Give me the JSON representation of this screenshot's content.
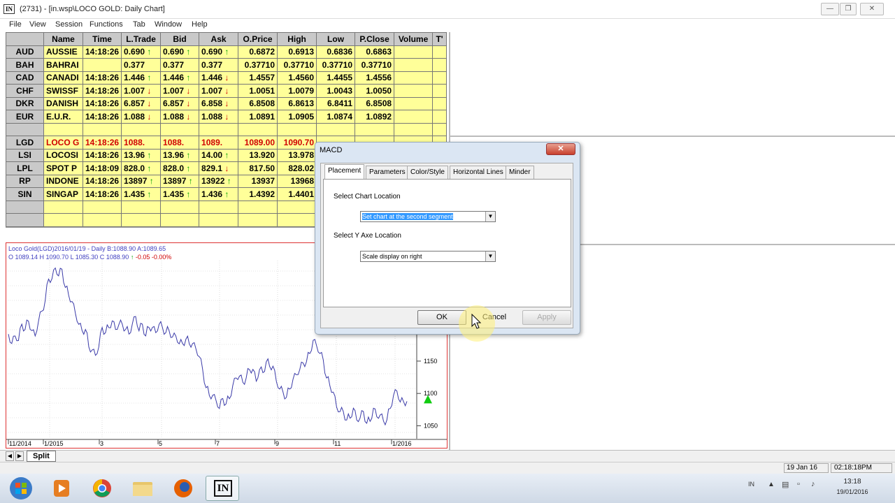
{
  "window": {
    "icon_text": "IN",
    "title": "(2731) - [in.wsp\\LOCO GOLD: Daily Chart]"
  },
  "menu": [
    "File",
    "View",
    "Session",
    "Functions",
    "Tab",
    "Window",
    "Help"
  ],
  "quotes": {
    "columns": [
      "",
      "Name",
      "Time",
      "L.Trade",
      "Bid",
      "Ask",
      "O.Price",
      "High",
      "Low",
      "P.Close",
      "Volume",
      "T'"
    ],
    "rows": [
      {
        "code": "AUD",
        "name": "AUSSIE",
        "time": "14:18:26",
        "ltrade": "0.690",
        "lt_dir": "up",
        "bid": "0.690",
        "bid_dir": "up",
        "ask": "0.690",
        "ask_dir": "up",
        "open": "0.6872",
        "high": "0.6913",
        "low": "0.6836",
        "pclose": "0.6863",
        "red": false
      },
      {
        "code": "BAH",
        "name": "BAHRAI",
        "time": "",
        "ltrade": "0.377",
        "lt_dir": "",
        "bid": "0.377",
        "bid_dir": "",
        "ask": "0.377",
        "ask_dir": "",
        "open": "0.37710",
        "high": "0.37710",
        "low": "0.37710",
        "pclose": "0.37710",
        "red": false
      },
      {
        "code": "CAD",
        "name": "CANADI",
        "time": "14:18:26",
        "ltrade": "1.446",
        "lt_dir": "up",
        "bid": "1.446",
        "bid_dir": "up",
        "ask": "1.446",
        "ask_dir": "down",
        "open": "1.4557",
        "high": "1.4560",
        "low": "1.4455",
        "pclose": "1.4556",
        "red": false
      },
      {
        "code": "CHF",
        "name": "SWISSF",
        "time": "14:18:26",
        "ltrade": "1.007",
        "lt_dir": "down",
        "bid": "1.007",
        "bid_dir": "down",
        "ask": "1.007",
        "ask_dir": "down",
        "open": "1.0051",
        "high": "1.0079",
        "low": "1.0043",
        "pclose": "1.0050",
        "red": false
      },
      {
        "code": "DKR",
        "name": "DANISH",
        "time": "14:18:26",
        "ltrade": "6.857",
        "lt_dir": "down",
        "bid": "6.857",
        "bid_dir": "down",
        "ask": "6.858",
        "ask_dir": "down",
        "open": "6.8508",
        "high": "6.8613",
        "low": "6.8411",
        "pclose": "6.8508",
        "red": false
      },
      {
        "code": "EUR",
        "name": "E.U.R.",
        "time": "14:18:26",
        "ltrade": "1.088",
        "lt_dir": "down",
        "bid": "1.088",
        "bid_dir": "down",
        "ask": "1.088",
        "ask_dir": "down",
        "open": "1.0891",
        "high": "1.0905",
        "low": "1.0874",
        "pclose": "1.0892",
        "red": false
      },
      {
        "code": "",
        "name": "",
        "time": "",
        "ltrade": "",
        "lt_dir": "",
        "bid": "",
        "bid_dir": "",
        "ask": "",
        "ask_dir": "",
        "open": "",
        "high": "",
        "low": "",
        "pclose": "",
        "red": false
      },
      {
        "code": "LGD",
        "name": "LOCO G",
        "time": "14:18:26",
        "ltrade": "1088.",
        "lt_dir": "",
        "bid": "1088.",
        "bid_dir": "",
        "ask": "1089.",
        "ask_dir": "",
        "open": "1089.00",
        "high": "1090.70",
        "low": "",
        "pclose": "",
        "red": true
      },
      {
        "code": "LSI",
        "name": "LOCOSI",
        "time": "14:18:26",
        "ltrade": "13.96",
        "lt_dir": "up",
        "bid": "13.96",
        "bid_dir": "up",
        "ask": "14.00",
        "ask_dir": "up",
        "open": "13.920",
        "high": "13.978",
        "low": "",
        "pclose": "",
        "red": false
      },
      {
        "code": "LPL",
        "name": "SPOT P",
        "time": "14:18:09",
        "ltrade": "828.0",
        "lt_dir": "up",
        "bid": "828.0",
        "bid_dir": "up",
        "ask": "829.1",
        "ask_dir": "down",
        "open": "817.50",
        "high": "828.02",
        "low": "",
        "pclose": "",
        "red": false
      },
      {
        "code": "RP",
        "name": "INDONE",
        "time": "14:18:26",
        "ltrade": "13897",
        "lt_dir": "up",
        "bid": "13897",
        "bid_dir": "up",
        "ask": "13922",
        "ask_dir": "up",
        "open": "13937",
        "high": "13968",
        "low": "",
        "pclose": "",
        "red": false
      },
      {
        "code": "SIN",
        "name": "SINGAP",
        "time": "14:18:26",
        "ltrade": "1.435",
        "lt_dir": "up",
        "bid": "1.435",
        "bid_dir": "up",
        "ask": "1.436",
        "ask_dir": "up",
        "open": "1.4392",
        "high": "1.4401",
        "low": "",
        "pclose": "",
        "red": false
      },
      {
        "code": "",
        "name": "",
        "time": "",
        "ltrade": "",
        "lt_dir": "",
        "bid": "",
        "bid_dir": "",
        "ask": "",
        "ask_dir": "",
        "open": "",
        "high": "",
        "low": "",
        "pclose": "",
        "red": false
      },
      {
        "code": "",
        "name": "",
        "time": "",
        "ltrade": "",
        "lt_dir": "",
        "bid": "",
        "bid_dir": "",
        "ask": "",
        "ask_dir": "",
        "open": "",
        "high": "",
        "low": "",
        "pclose": "",
        "red": false
      }
    ]
  },
  "chart": {
    "header1": "Loco Gold(LGD)2016/01/19  - Daily B:1088.90 A:1089.65",
    "header2": "O 1089.14 H 1090.70 L 1085.30 C 1088.90",
    "change": "-0.05 -0.00%",
    "colors": {
      "line": "#3a3aa8",
      "border": "#dd3333",
      "marker": "#11cc11"
    }
  },
  "chart_data": {
    "type": "line",
    "title": "",
    "x_ticks": [
      "11/2014",
      "1/2015",
      "3",
      "5",
      "7",
      "9",
      "11",
      "1/2016"
    ],
    "y_ticks": [
      1150,
      1100,
      1050
    ],
    "ylim": [
      1030,
      1300
    ],
    "series": [
      {
        "values": [
          1195,
          1175,
          1190,
          1185,
          1205,
          1200,
          1215,
          1195,
          1190,
          1215,
          1225,
          1245,
          1280,
          1275,
          1295,
          1285,
          1290,
          1265,
          1255,
          1240,
          1225,
          1210,
          1195,
          1200,
          1175,
          1165,
          1160,
          1175,
          1200,
          1195,
          1205,
          1210,
          1200,
          1210,
          1205,
          1200,
          1195,
          1205,
          1220,
          1200,
          1205,
          1190,
          1205,
          1200,
          1195,
          1210,
          1200,
          1195,
          1200,
          1185,
          1190,
          1180,
          1175,
          1185,
          1180,
          1175,
          1170,
          1160,
          1135,
          1110,
          1100,
          1095,
          1090,
          1080,
          1090,
          1085,
          1095,
          1110,
          1125,
          1130,
          1115,
          1125,
          1140,
          1135,
          1120,
          1140,
          1130,
          1150,
          1145,
          1140,
          1120,
          1110,
          1100,
          1095,
          1110,
          1120,
          1130,
          1140,
          1145,
          1150,
          1165,
          1180,
          1175,
          1165,
          1150,
          1125,
          1115,
          1100,
          1080,
          1075,
          1070,
          1060,
          1065,
          1075,
          1060,
          1065,
          1070,
          1055,
          1060,
          1075,
          1065,
          1070,
          1055,
          1060,
          1080,
          1095,
          1105,
          1090,
          1085,
          1089
        ]
      }
    ]
  },
  "dialog": {
    "title": "MACD",
    "tabs": [
      "Placement",
      "Parameters",
      "Color/Style",
      "Horizontal Lines",
      "Minder"
    ],
    "active_tab": "Placement",
    "chart_location_label": "Select Chart Location",
    "chart_location_value": "Set chart at the second segment",
    "y_axis_label": "Select Y Axe Location",
    "y_axis_value": "Scale display on right",
    "ok": "OK",
    "cancel": "Cancel",
    "apply": "Apply"
  },
  "sheet_tab": "Split",
  "status": {
    "date": "19 Jan 16",
    "time": "02:18:18PM"
  },
  "taskbar": {
    "app_label": "IN",
    "lang": "IN",
    "clock_time": "13:18",
    "clock_date": "19/01/2016"
  }
}
